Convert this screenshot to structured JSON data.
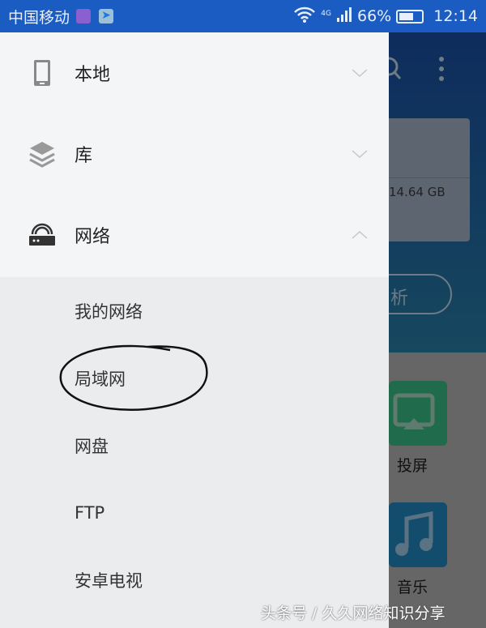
{
  "status": {
    "carrier": "中国移动",
    "network": "4G",
    "battery": "66%",
    "time": "12:14"
  },
  "background": {
    "storage": "14.64 GB",
    "analyze_partial": "析",
    "tiles": [
      {
        "label": "投屏",
        "color": "#1f6b4c"
      },
      {
        "label": "音乐",
        "color": "#134d6e"
      }
    ]
  },
  "drawer": {
    "items": [
      {
        "label": "本地",
        "icon": "phone-icon",
        "expanded": false
      },
      {
        "label": "库",
        "icon": "layers-icon",
        "expanded": false
      },
      {
        "label": "网络",
        "icon": "router-icon",
        "expanded": true
      }
    ],
    "network_sub": [
      "我的网络",
      "局域网",
      "网盘",
      "FTP",
      "安卓电视"
    ]
  },
  "watermark": "头条号 / 久久网络知识分享",
  "colors": {
    "status_bar": "#1b5cc2",
    "drawer_top": "#f4f5f7",
    "drawer_sub": "#ebecee"
  }
}
